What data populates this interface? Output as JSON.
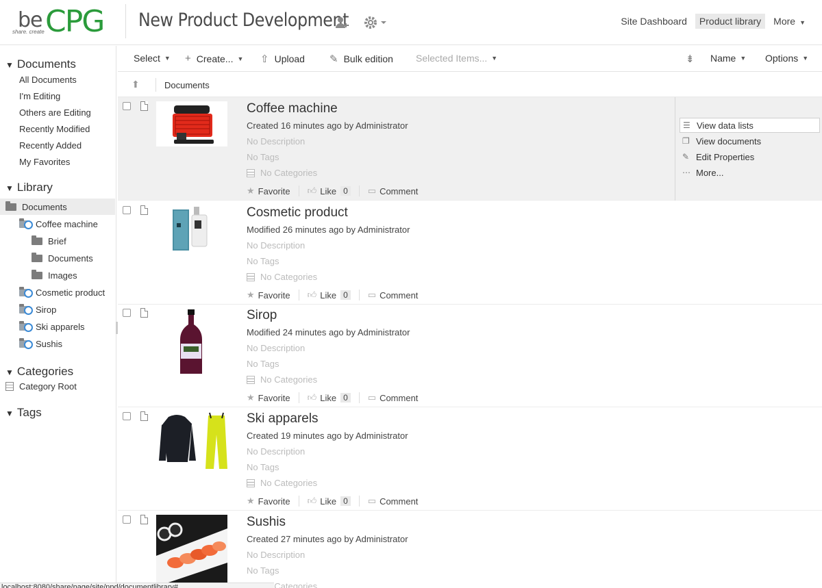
{
  "header": {
    "logo_be": "be",
    "logo_cpg": "CPG",
    "logo_tagline": "share. create",
    "site_title": "New Product Development",
    "nav": {
      "site_dashboard": "Site Dashboard",
      "product_library": "Product library",
      "more": "More"
    }
  },
  "sidebar": {
    "documents_heading": "Documents",
    "document_links": [
      "All Documents",
      "I'm Editing",
      "Others are Editing",
      "Recently Modified",
      "Recently Added",
      "My Favorites"
    ],
    "library_heading": "Library",
    "tree": {
      "root": "Documents",
      "coffee": "Coffee machine",
      "brief": "Brief",
      "documents": "Documents",
      "images": "Images",
      "cosmetic": "Cosmetic product",
      "sirop": "Sirop",
      "ski": "Ski apparels",
      "sushis": "Sushis"
    },
    "categories_heading": "Categories",
    "category_root": "Category Root",
    "tags_heading": "Tags"
  },
  "toolbar": {
    "select": "Select",
    "create": "Create...",
    "upload": "Upload",
    "bulk_edition": "Bulk edition",
    "selected_items": "Selected Items...",
    "sort_name": "Name",
    "options": "Options"
  },
  "breadcrumb": {
    "path": "Documents"
  },
  "items": [
    {
      "title": "Coffee machine",
      "meta": "Created 16 minutes ago by Administrator",
      "description": "No Description",
      "tags": "No Tags",
      "categories": "No Categories",
      "favorite": "Favorite",
      "like": "Like",
      "like_count": "0",
      "comment": "Comment"
    },
    {
      "title": "Cosmetic product",
      "meta": "Modified 26 minutes ago by Administrator",
      "description": "No Description",
      "tags": "No Tags",
      "categories": "No Categories",
      "favorite": "Favorite",
      "like": "Like",
      "like_count": "0",
      "comment": "Comment"
    },
    {
      "title": "Sirop",
      "meta": "Modified 24 minutes ago by Administrator",
      "description": "No Description",
      "tags": "No Tags",
      "categories": "No Categories",
      "favorite": "Favorite",
      "like": "Like",
      "like_count": "0",
      "comment": "Comment"
    },
    {
      "title": "Ski apparels",
      "meta": "Created 19 minutes ago by Administrator",
      "description": "No Description",
      "tags": "No Tags",
      "categories": "No Categories",
      "favorite": "Favorite",
      "like": "Like",
      "like_count": "0",
      "comment": "Comment"
    },
    {
      "title": "Sushis",
      "meta": "Created 27 minutes ago by Administrator",
      "description": "No Description",
      "tags": "No Tags",
      "categories": "No Categories"
    }
  ],
  "item_actions": {
    "view_data_lists": "View data lists",
    "view_documents": "View documents",
    "edit_properties": "Edit Properties",
    "more": "More..."
  },
  "status_bar": "localhost:8080/share/page/site/npd/documentlibrary#",
  "colors": {
    "brand_green": "#2b9b3b",
    "row_highlight": "#f0f0f0",
    "accent_blue": "#3a8ad6"
  }
}
